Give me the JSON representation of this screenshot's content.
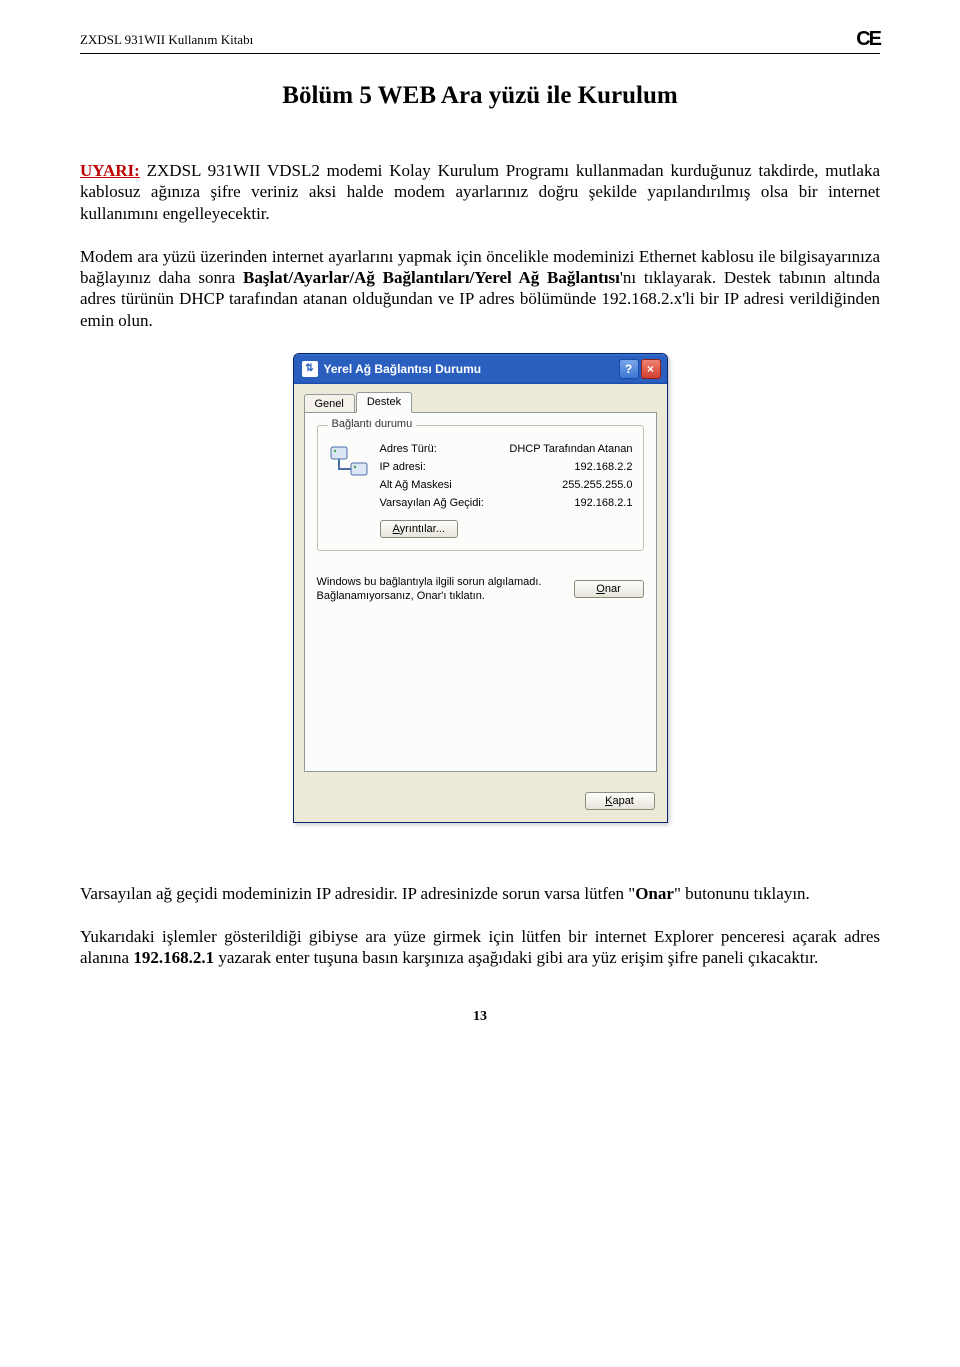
{
  "header": {
    "doc_title": "ZXDSL 931WII Kullanım Kitabı",
    "ce_mark": "CE"
  },
  "section_title": "Bölüm 5  WEB Ara yüzü ile Kurulum",
  "p1_prefix": "UYARI:",
  "p1_body": " ZXDSL 931WII VDSL2 modemi Kolay Kurulum Programı kullanmadan kurduğunuz takdirde, mutlaka kablosuz ağınıza şifre veriniz aksi halde modem ayarlarınız doğru şekilde yapılandırılmış olsa bir internet kullanımını engelleyecektir.",
  "p2_a": "Modem ara yüzü üzerinden internet ayarlarını yapmak için öncelikle modeminizi Ethernet kablosu ile bilgisayarınıza bağlayınız daha sonra ",
  "p2_bold": "Başlat/Ayarlar/Ağ Bağlantıları/Yerel Ağ Bağlantısı",
  "p2_b": "'nı tıklayarak. Destek tabının altında adres türünün DHCP tarafından atanan olduğundan ve IP adres bölümünde 192.168.2.x'li bir IP adresi verildiğinden emin olun.",
  "dialog": {
    "title": "Yerel Ağ Bağlantısı Durumu",
    "tabs": {
      "general": "Genel",
      "support": "Destek"
    },
    "group_title": "Bağlantı durumu",
    "rows": {
      "r0_label": "Adres Türü:",
      "r0_value": "DHCP Tarafından Atanan",
      "r1_label": "IP adresi:",
      "r1_value": "192.168.2.2",
      "r2_label": "Alt Ağ Maskesi",
      "r2_value": "255.255.255.0",
      "r3_label": "Varsayılan Ağ Geçidi:",
      "r3_value": "192.168.2.1"
    },
    "details_btn_u": "A",
    "details_btn_rest": "yrıntılar...",
    "repair_text": "Windows bu bağlantıyla ilgili sorun algılamadı. Bağlanamıyorsanız, Onar'ı tıklatın.",
    "repair_btn_u": "O",
    "repair_btn_rest": "nar",
    "close_btn_u": "K",
    "close_btn_rest": "apat"
  },
  "p3_a": "Varsayılan ağ geçidi modeminizin IP adresidir. IP adresinizde sorun varsa lütfen \"",
  "p3_bold": "Onar",
  "p3_b": "\" butonunu tıklayın.",
  "p4_a": "Yukarıdaki işlemler gösterildiği gibiyse ara yüze girmek için lütfen bir internet Explorer penceresi açarak adres alanına ",
  "p4_bold": "192.168.2.1",
  "p4_b": " yazarak enter tuşuna basın karşınıza aşağıdaki gibi ara yüz erişim şifre paneli çıkacaktır.",
  "page_number": "13"
}
